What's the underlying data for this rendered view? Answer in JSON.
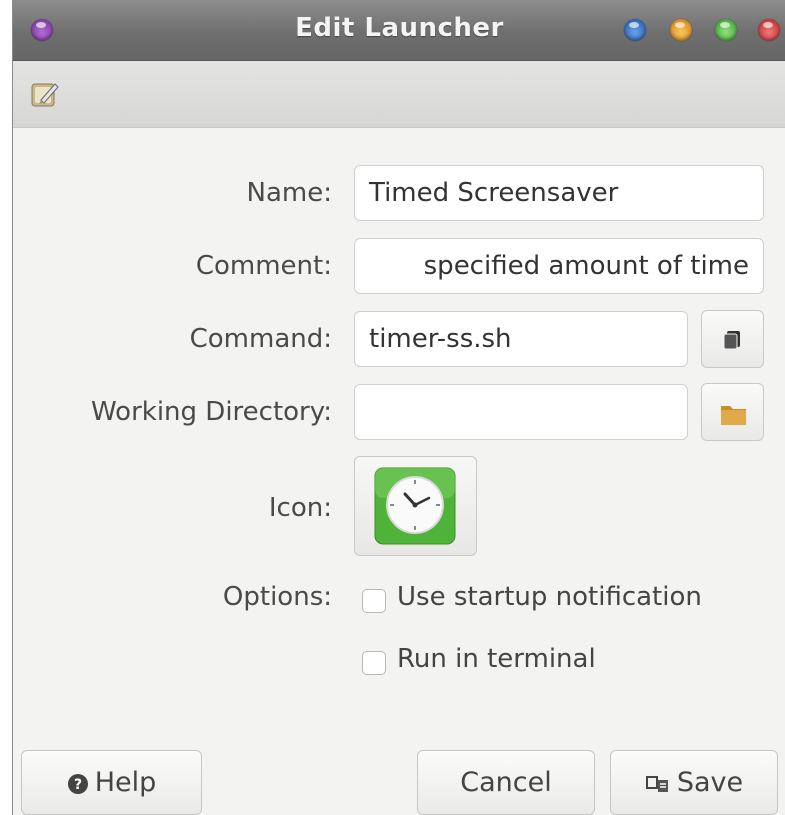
{
  "window": {
    "title": "Edit Launcher"
  },
  "form": {
    "name": {
      "label": "Name:",
      "value": "Timed Screensaver"
    },
    "comment": {
      "label": "Comment:",
      "value": "specified amount of time"
    },
    "command": {
      "label": "Command:",
      "value": "timer-ss.sh"
    },
    "working_directory": {
      "label": "Working Directory:",
      "value": ""
    },
    "icon": {
      "label": "Icon:",
      "icon_name": "clock-icon"
    },
    "options": {
      "label": "Options:",
      "startup_notification": {
        "label": "Use startup notification",
        "checked": false
      },
      "run_in_terminal": {
        "label": "Run in terminal",
        "checked": false
      }
    }
  },
  "buttons": {
    "help": "Help",
    "cancel": "Cancel",
    "save": "Save"
  },
  "colors": {
    "titlebar": "#777777",
    "window_bg": "#f3f3f2",
    "icon_green": "#4fb33a",
    "folder_tan": "#d9a040"
  }
}
